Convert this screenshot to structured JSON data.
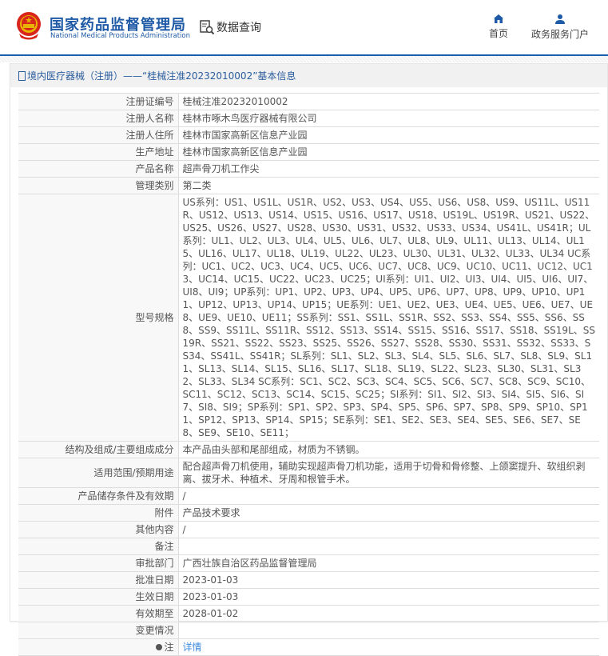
{
  "header": {
    "title_cn": "国家药品监督管理局",
    "title_en": "National Medical Products Administration",
    "data_query": "数据查询",
    "nav": [
      {
        "label": "首页",
        "icon": "home-icon"
      },
      {
        "label": "政务服务门户",
        "icon": "user-icon"
      }
    ]
  },
  "breadcrumb": "境内医疗器械（注册）——“桂械注准20232010002”基本信息",
  "rows": [
    {
      "label": "注册证编号",
      "value": "桂械注准20232010002"
    },
    {
      "label": "注册人名称",
      "value": "桂林市啄木鸟医疗器械有限公司"
    },
    {
      "label": "注册人住所",
      "value": "桂林市国家高新区信息产业园"
    },
    {
      "label": "生产地址",
      "value": "桂林市国家高新区信息产业园"
    },
    {
      "label": "产品名称",
      "value": "超声骨刀机工作尖"
    },
    {
      "label": "管理类别",
      "value": "第二类"
    },
    {
      "label": "型号规格",
      "value": "US系列：US1、US1L、US1R、US2、US3、US4、US5、US6、US8、US9、US11L、US11R、US12、US13、US14、US15、US16、US17、US18、US19L、US19R、US21、US22、US25、US26、US27、US28、US30、US31、US32、US33、US34、US41L、US41R；UL系列：UL1、UL2、UL3、UL4、UL5、UL6、UL7、UL8、UL9、UL11、UL13、UL14、UL15、UL16、UL17、UL18、UL19、UL22、UL23、UL30、UL31、UL32、UL33、UL34 UC系列：UC1、UC2、UC3、UC4、UC5、UC6、UC7、UC8、UC9、UC10、UC11、UC12、UC13、UC14、UC15、UC22、UC23、UC25；UI系列：UI1、UI2、UI3、UI4、UI5、UI6、UI7、UI8、UI9；UP系列：UP1、UP2、UP3、UP4、UP5、UP6、UP7、UP8、UP9、UP10、UP11、UP12、UP13、UP14、UP15；UE系列：UE1、UE2、UE3、UE4、UE5、UE6、UE7、UE8、UE9、UE10、UE11；SS系列：SS1、SS1L、SS1R、SS2、SS3、SS4、SS5、SS6、SS8、SS9、SS11L、SS11R、SS12、SS13、SS14、SS15、SS16、SS17、SS18、SS19L、SS19R、SS21、SS22、SS23、SS25、SS26、SS27、SS28、SS30、SS31、SS32、SS33、SS34、SS41L、SS41R；SL系列：SL1、SL2、SL3、SL4、SL5、SL6、SL7、SL8、SL9、SL11、SL13、SL14、SL15、SL16、SL17、SL18、SL19、SL22、SL23、SL30、SL31、SL32、SL33、SL34 SC系列：SC1、SC2、SC3、SC4、SC5、SC6、SC7、SC8、SC9、SC10、SC11、SC12、SC13、SC14、SC15、SC25；SI系列：SI1、SI2、SI3、SI4、SI5、SI6、SI7、SI8、SI9；SP系列：SP1、SP2、SP3、SP4、SP5、SP6、SP7、SP8、SP9、SP10、SP11、SP12、SP13、SP14、SP15；SE系列：SE1、SE2、SE3、SE4、SE5、SE6、SE7、SE8、SE9、SE10、SE11；"
    },
    {
      "label": "结构及组成/主要组成成分",
      "value": "本产品由头部和尾部组成，材质为不锈钢。"
    },
    {
      "label": "适用范围/预期用途",
      "value": "配合超声骨刀机使用，辅助实现超声骨刀机功能，适用于切骨和骨修整、上颌窦提升、软组织剥离、拔牙术、种植术、牙周和根管手术。"
    },
    {
      "label": "产品储存条件及有效期",
      "value": "/"
    },
    {
      "label": "附件",
      "value": "产品技术要求"
    },
    {
      "label": "其他内容",
      "value": "/"
    },
    {
      "label": "备注",
      "value": ""
    },
    {
      "label": "审批部门",
      "value": "广西壮族自治区药品监督管理局"
    },
    {
      "label": "批准日期",
      "value": "2023-01-03"
    },
    {
      "label": "生效日期",
      "value": "2023-01-03"
    },
    {
      "label": "有效期至",
      "value": "2028-01-02"
    },
    {
      "label": "变更情况",
      "value": ""
    }
  ],
  "note": {
    "label": "注",
    "link": "详情",
    "icon": "pin-icon"
  },
  "colors": {
    "brand": "#1f5aa6",
    "link": "#3b8be0"
  }
}
